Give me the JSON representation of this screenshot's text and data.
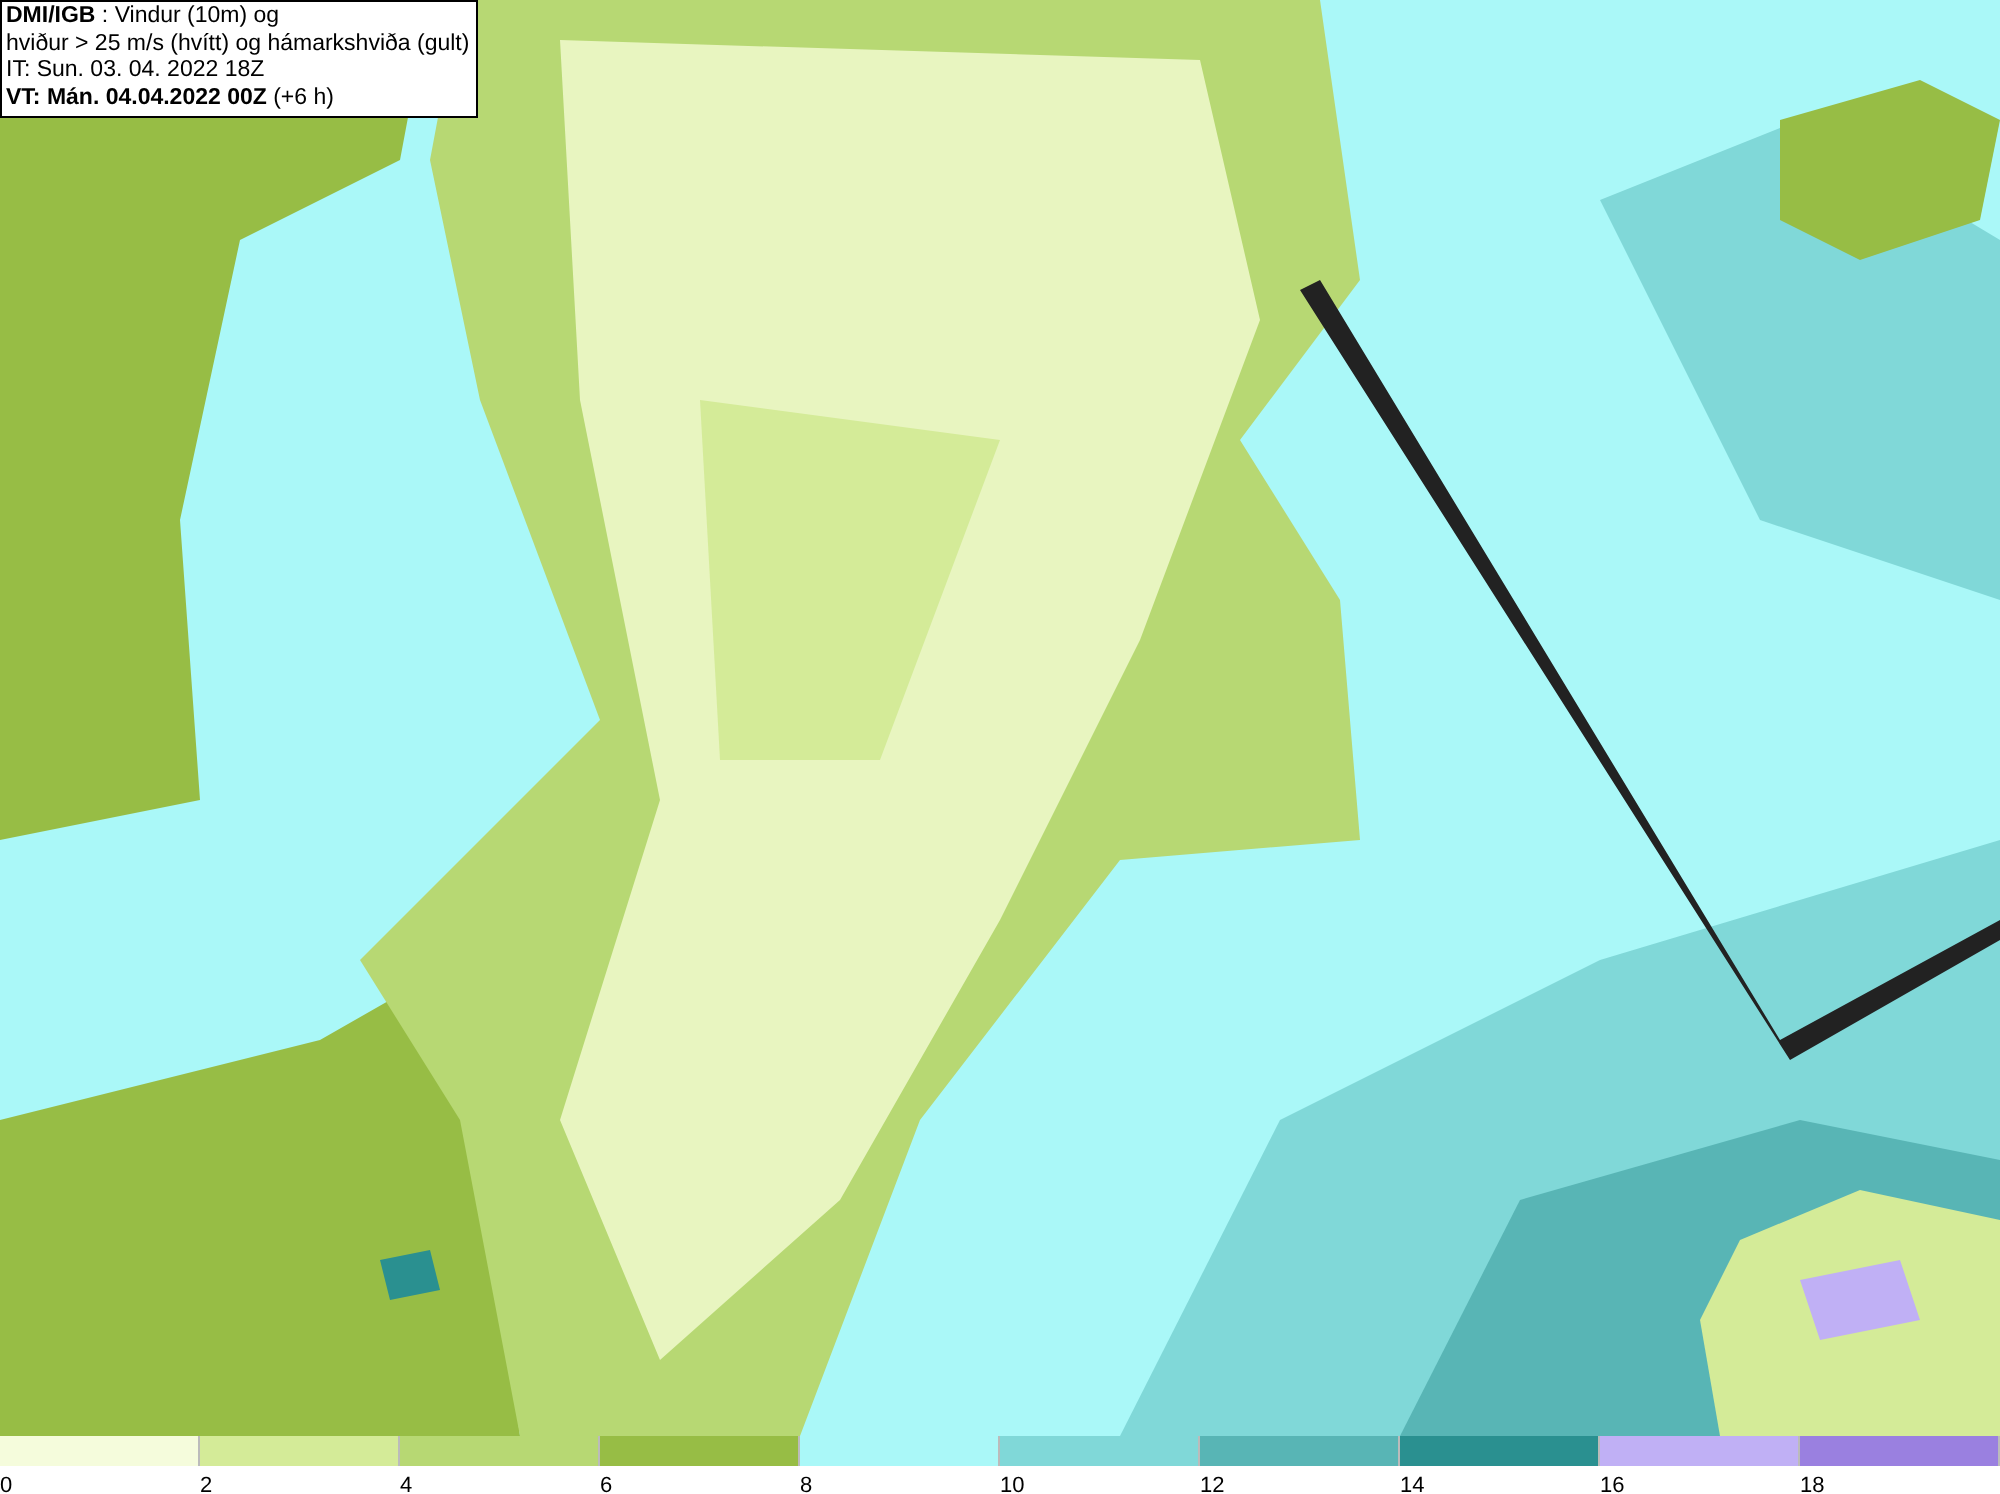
{
  "title_box": {
    "lines": [
      "**DMI/IGB** : Vindur (10m) og",
      "hviður > 25 m/s (hvítt) og hámarkshviða (gult)",
      "IT: Sun. 03. 04. 2022 18Z",
      "**VT: Mán. 04.04.2022 00Z** (+6 h)"
    ]
  },
  "legend": {
    "swatches": [
      {
        "label": "0",
        "color": "#f5fcdc"
      },
      {
        "label": "2",
        "color": "#d4eb98"
      },
      {
        "label": "4",
        "color": "#b7d873"
      },
      {
        "label": "6",
        "color": "#97bd45"
      },
      {
        "label": "8",
        "color": "#aaf8f8"
      },
      {
        "label": "10",
        "color": "#80d8d8"
      },
      {
        "label": "12",
        "color": "#58b5b5"
      },
      {
        "label": "14",
        "color": "#2a9090"
      },
      {
        "label": "16",
        "color": "#c0b0f5"
      },
      {
        "label": "18",
        "color": "#9a80e0"
      }
    ]
  }
}
